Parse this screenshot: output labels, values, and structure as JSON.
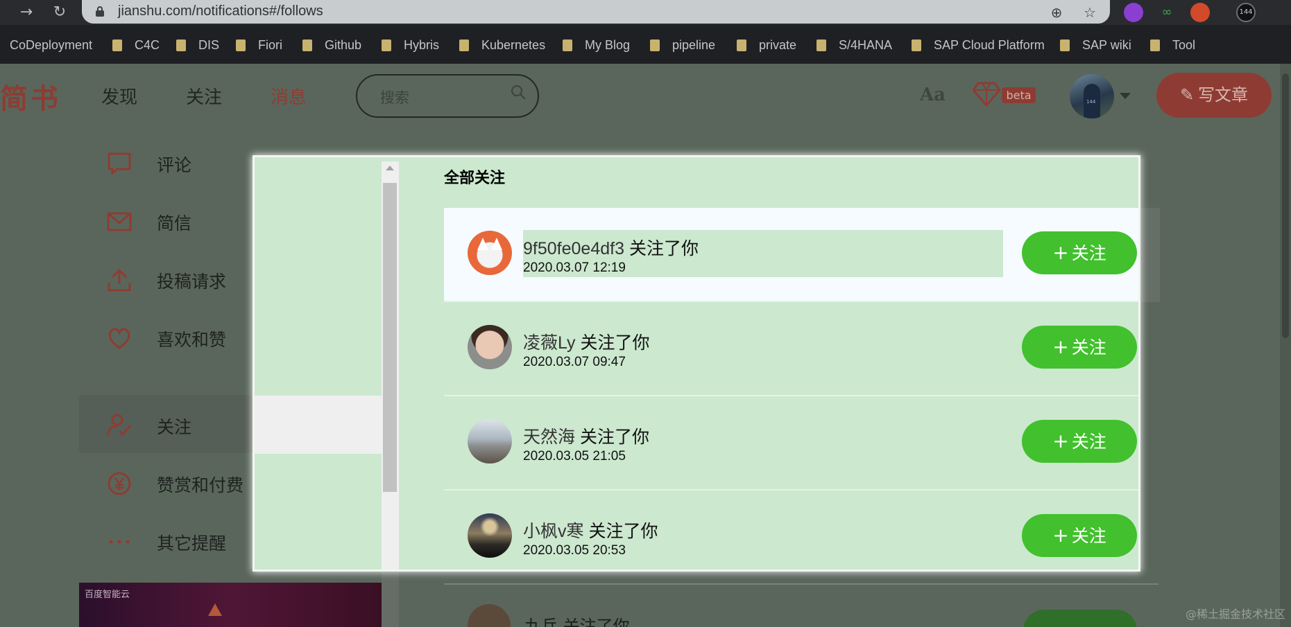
{
  "browser": {
    "url": "jianshu.com/notifications#/follows",
    "extension_badge": "144",
    "bookmarks": [
      "CoDeployment",
      "C4C",
      "DIS",
      "Fiori",
      "Github",
      "Hybris",
      "Kubernetes",
      "My Blog",
      "pipeline",
      "private",
      "S/4HANA",
      "SAP Cloud Platform",
      "SAP wiki",
      "Tool"
    ]
  },
  "header": {
    "logo": "简书",
    "nav": [
      "发现",
      "关注",
      "消息"
    ],
    "search_placeholder": "搜索",
    "font_toggle": "Aa",
    "beta": "beta",
    "write": "写文章",
    "avatar_number": "144"
  },
  "sidebar": {
    "items": [
      {
        "icon": "comment-icon",
        "label": "评论"
      },
      {
        "icon": "mail-icon",
        "label": "简信"
      },
      {
        "icon": "upload-icon",
        "label": "投稿请求"
      },
      {
        "icon": "heart-icon",
        "label": "喜欢和赞"
      },
      {
        "icon": "follow-user-icon",
        "label": "关注"
      },
      {
        "icon": "yen-icon",
        "label": "赞赏和付费"
      },
      {
        "icon": "more-icon",
        "label": "其它提醒"
      }
    ],
    "active_index": 4,
    "ad_text": "百度智能云"
  },
  "follows": {
    "title": "全部关注",
    "follow_button_label": "关注",
    "action_text": "关注了你",
    "items": [
      {
        "user": "9f50fe0e4df3",
        "time": "2020.03.07 12:19",
        "avatar": "fox"
      },
      {
        "user": "凌薇Ly",
        "time": "2020.03.07 09:47",
        "avatar": "kid"
      },
      {
        "user": "天然海",
        "time": "2020.03.05 21:05",
        "avatar": "sea"
      },
      {
        "user": "小枫v寒",
        "time": "2020.03.05 20:53",
        "avatar": "sky"
      },
      {
        "user": "九兵",
        "avatar": "brown"
      }
    ]
  },
  "watermark": "@稀土掘金技术社区",
  "colors": {
    "brand": "#ea6f5a",
    "follow_green": "#42c02e",
    "highlight_overlay": "#cce8cf"
  }
}
